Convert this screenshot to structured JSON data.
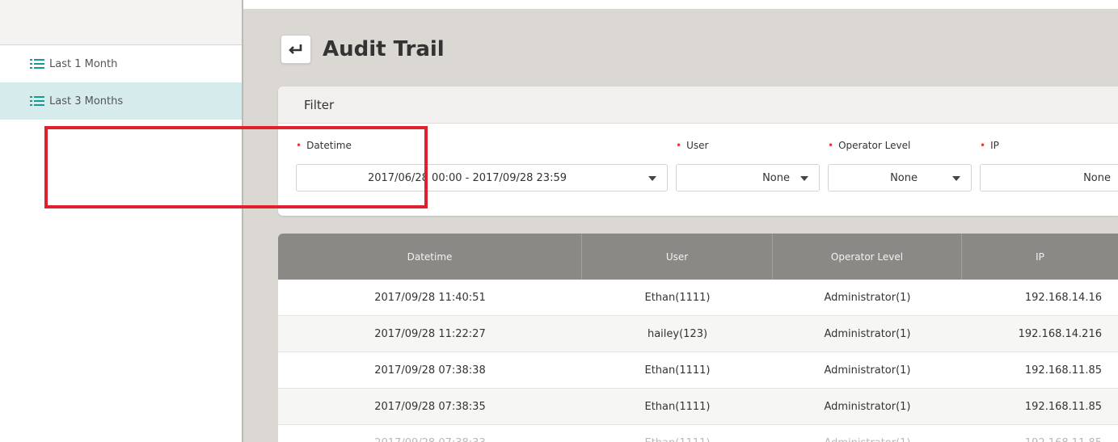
{
  "sidebar": {
    "items": [
      {
        "label": "Last 1 Month",
        "icon": "list-icon",
        "active": false
      },
      {
        "label": "Last 3 Months",
        "icon": "list-icon",
        "active": true
      }
    ]
  },
  "header": {
    "title": "Audit Trail",
    "back_icon": "return-arrow-icon"
  },
  "filter": {
    "title": "Filter",
    "fields": {
      "datetime": {
        "label": "Datetime",
        "value": "2017/06/28 00:00 - 2017/09/28 23:59"
      },
      "user": {
        "label": "User",
        "value": "None"
      },
      "operator_level": {
        "label": "Operator Level",
        "value": "None"
      },
      "ip": {
        "label": "IP",
        "value": "None"
      }
    }
  },
  "table": {
    "headers": [
      "Datetime",
      "User",
      "Operator Level",
      "IP"
    ],
    "rows": [
      [
        "2017/09/28 11:40:51",
        "Ethan(1111)",
        "Administrator(1)",
        "192.168.14.16"
      ],
      [
        "2017/09/28 11:22:27",
        "hailey(123)",
        "Administrator(1)",
        "192.168.14.216"
      ],
      [
        "2017/09/28 07:38:38",
        "Ethan(1111)",
        "Administrator(1)",
        "192.168.11.85"
      ],
      [
        "2017/09/28 07:38:35",
        "Ethan(1111)",
        "Administrator(1)",
        "192.168.11.85"
      ],
      [
        "2017/09/28 07:38:33",
        "Ethan(1111)",
        "Administrator(1)",
        "192.168.11.85"
      ]
    ]
  },
  "colors": {
    "accent_red": "#e0202a",
    "active_item": "#d6ecec",
    "table_header": "#8b8986",
    "main_bg": "#dbd8d3"
  }
}
